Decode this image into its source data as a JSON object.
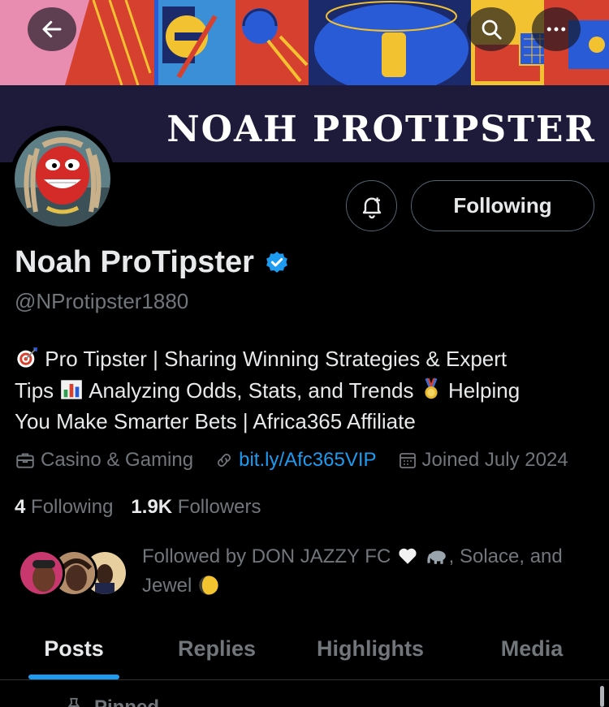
{
  "banner": {
    "title": "NOAH PROTIPSTER",
    "colors": {
      "strip": "#1e1a3a",
      "red": "#d6402f",
      "blue": "#2a5bd7",
      "yellow": "#f2c230",
      "navy": "#1b2a6b",
      "pink": "#e98db0"
    }
  },
  "top_bar": {
    "back_icon": "arrow-left-icon",
    "search_icon": "search-icon",
    "more_icon": "more-dots-icon"
  },
  "profile": {
    "display_name": "Noah ProTipster",
    "verified_icon": "verified-badge-icon",
    "handle": "@NProtipster1880",
    "follow_button_label": "Following",
    "notify_icon": "bell-plus-icon",
    "bio": {
      "line1": "Pro Tipster | Sharing Winning Strategies & Expert",
      "line2_a": "Tips",
      "line2_b": "Analyzing Odds, Stats, and Trends",
      "line2_c": "Helping",
      "line3": "You Make Smarter Bets | Africa365 Affiliate",
      "emoji_icons": [
        "target-icon",
        "bar-chart-icon",
        "medal-icon"
      ]
    },
    "meta": {
      "category": "Casino & Gaming",
      "link": "bit.ly/Afc365VIP",
      "joined": "Joined July 2024"
    },
    "stats": {
      "following_count": "4",
      "following_label": "Following",
      "followers_count": "1.9K",
      "followers_label": "Followers"
    },
    "followed_by": {
      "prefix": "Followed by DON JAZZY FC",
      "middle": ", Solace, and",
      "last": "Jewel"
    }
  },
  "tabs": [
    {
      "label": "Posts",
      "active": true
    },
    {
      "label": "Replies",
      "active": false
    },
    {
      "label": "Highlights",
      "active": false
    },
    {
      "label": "Media",
      "active": false
    }
  ],
  "pinned_label": "Pinned",
  "accent_color": "#1d9bf0"
}
